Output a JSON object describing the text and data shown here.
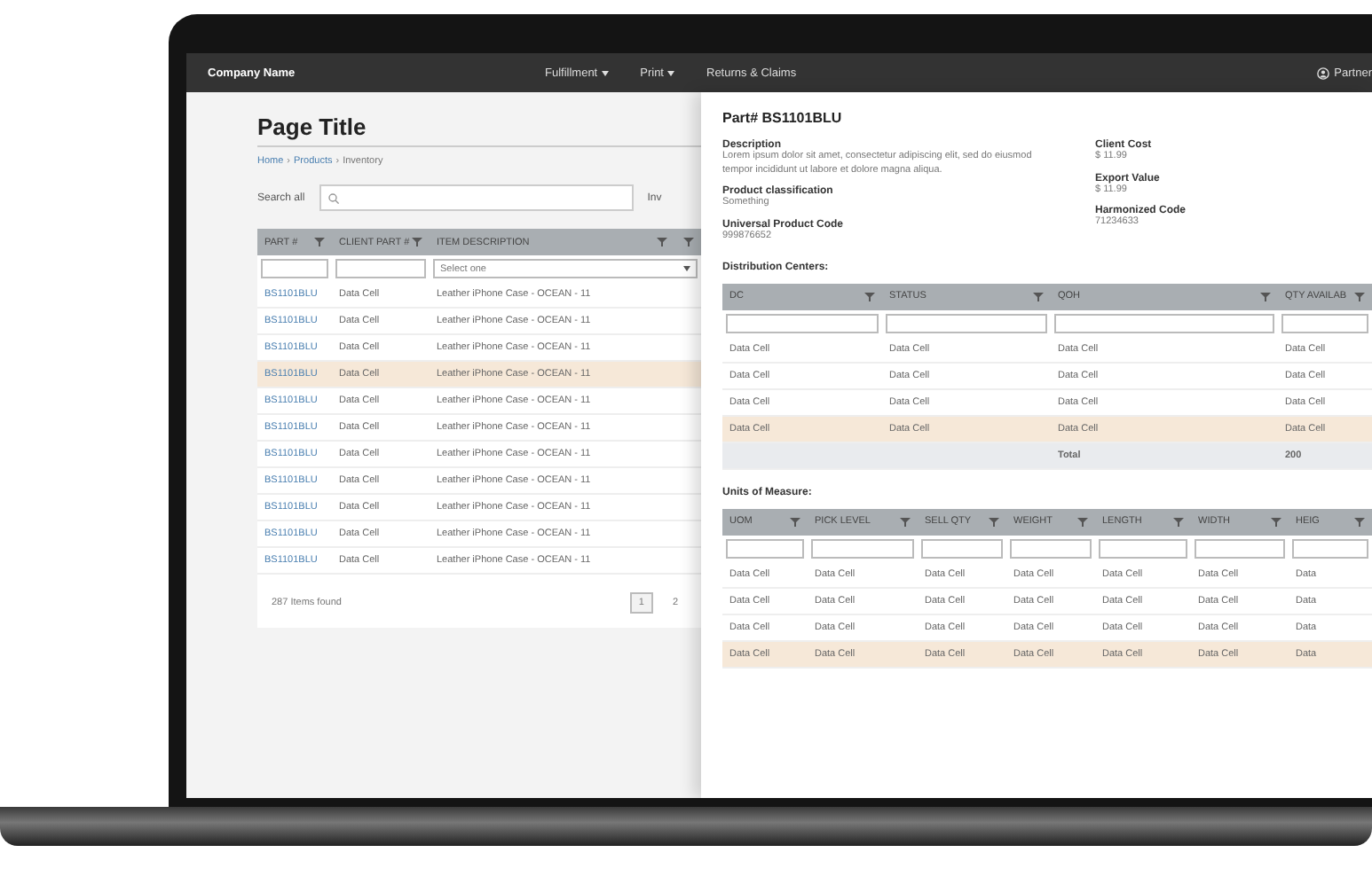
{
  "nav": {
    "brand": "Company Name",
    "menus": [
      {
        "label": "Fulfillment",
        "dropdown": true
      },
      {
        "label": "Print",
        "dropdown": true
      },
      {
        "label": "Returns & Claims",
        "dropdown": false
      }
    ],
    "user": "Partner"
  },
  "list": {
    "title": "Page Title",
    "breadcrumb": [
      "Home",
      "Products",
      "Inventory"
    ],
    "breadcrumb_separator": "›",
    "search_label": "Search all",
    "side_label": "Inv",
    "columns": [
      "PART #",
      "CLIENT PART #",
      "ITEM DESCRIPTION",
      ""
    ],
    "filter_select": "Select one",
    "rows": [
      {
        "part": "BS1101BLU",
        "client_part": "Data Cell",
        "description": "Leather iPhone Case - OCEAN - 11",
        "selected": false
      },
      {
        "part": "BS1101BLU",
        "client_part": "Data Cell",
        "description": "Leather iPhone Case - OCEAN - 11",
        "selected": false
      },
      {
        "part": "BS1101BLU",
        "client_part": "Data Cell",
        "description": "Leather iPhone Case - OCEAN - 11",
        "selected": false
      },
      {
        "part": "BS1101BLU",
        "client_part": "Data Cell",
        "description": "Leather iPhone Case - OCEAN - 11",
        "selected": true
      },
      {
        "part": "BS1101BLU",
        "client_part": "Data Cell",
        "description": "Leather iPhone Case - OCEAN - 11",
        "selected": false
      },
      {
        "part": "BS1101BLU",
        "client_part": "Data Cell",
        "description": "Leather iPhone Case - OCEAN - 11",
        "selected": false
      },
      {
        "part": "BS1101BLU",
        "client_part": "Data Cell",
        "description": "Leather iPhone Case - OCEAN - 11",
        "selected": false
      },
      {
        "part": "BS1101BLU",
        "client_part": "Data Cell",
        "description": "Leather iPhone Case - OCEAN - 11",
        "selected": false
      },
      {
        "part": "BS1101BLU",
        "client_part": "Data Cell",
        "description": "Leather iPhone Case - OCEAN - 11",
        "selected": false
      },
      {
        "part": "BS1101BLU",
        "client_part": "Data Cell",
        "description": "Leather iPhone Case - OCEAN - 11",
        "selected": false
      },
      {
        "part": "BS1101BLU",
        "client_part": "Data Cell",
        "description": "Leather iPhone Case - OCEAN - 11",
        "selected": false
      }
    ],
    "count": "287 Items found",
    "pages": [
      {
        "label": "1",
        "selected": true
      },
      {
        "label": "2",
        "selected": false
      }
    ]
  },
  "detail": {
    "title": "Part# BS1101BLU",
    "fields_left": [
      {
        "label": "Description",
        "value": "Lorem ipsum dolor sit amet, consectetur adipiscing elit, sed do eiusmod tempor incididunt ut labore et dolore magna aliqua."
      },
      {
        "label": "Product classification",
        "value": "Something"
      },
      {
        "label": "Universal Product Code",
        "value": "999876652"
      }
    ],
    "fields_right": [
      {
        "label": "Client Cost",
        "value": "$ 11.99"
      },
      {
        "label": "Export Value",
        "value": "$ 11.99"
      },
      {
        "label": "Harmonized Code",
        "value": "71234633"
      }
    ],
    "distribution": {
      "title": "Distribution Centers:",
      "columns": [
        "DC",
        "STATUS",
        "QOH",
        "QTY AVAILAB"
      ],
      "rows": [
        {
          "kind": "data",
          "cells": [
            "Data Cell",
            "Data Cell",
            "Data Cell",
            "Data Cell"
          ],
          "selected": false
        },
        {
          "kind": "data",
          "cells": [
            "Data Cell",
            "Data Cell",
            "Data Cell",
            "Data Cell"
          ],
          "selected": false
        },
        {
          "kind": "data",
          "cells": [
            "Data Cell",
            "Data Cell",
            "Data Cell",
            "Data Cell"
          ],
          "selected": false
        },
        {
          "kind": "data",
          "cells": [
            "Data Cell",
            "Data Cell",
            "Data Cell",
            "Data Cell"
          ],
          "selected": true
        },
        {
          "kind": "total",
          "cells": [
            "",
            "",
            "Total",
            "200"
          ],
          "selected": false
        }
      ]
    },
    "units": {
      "title": "Units of Measure:",
      "columns": [
        "UOM",
        "PICK LEVEL",
        "SELL QTY",
        "WEIGHT",
        "LENGTH",
        "WIDTH",
        "HEIG"
      ],
      "rows": [
        {
          "kind": "data",
          "cells": [
            "Data Cell",
            "Data Cell",
            "Data Cell",
            "Data Cell",
            "Data Cell",
            "Data Cell",
            "Data"
          ],
          "selected": false
        },
        {
          "kind": "data",
          "cells": [
            "Data Cell",
            "Data Cell",
            "Data Cell",
            "Data Cell",
            "Data Cell",
            "Data Cell",
            "Data"
          ],
          "selected": false
        },
        {
          "kind": "data",
          "cells": [
            "Data Cell",
            "Data Cell",
            "Data Cell",
            "Data Cell",
            "Data Cell",
            "Data Cell",
            "Data"
          ],
          "selected": false
        },
        {
          "kind": "data",
          "cells": [
            "Data Cell",
            "Data Cell",
            "Data Cell",
            "Data Cell",
            "Data Cell",
            "Data Cell",
            "Data"
          ],
          "selected": true
        }
      ]
    }
  }
}
